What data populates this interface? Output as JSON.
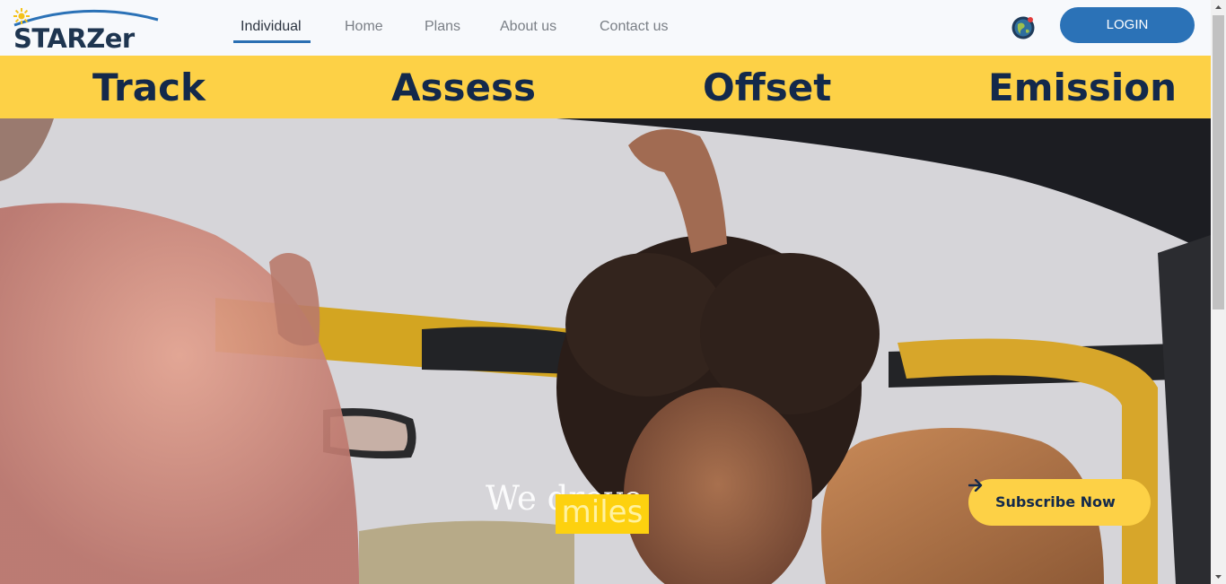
{
  "brand": {
    "logo_text": "STARZer",
    "logo_icon": "sun-icon"
  },
  "nav": {
    "items": [
      {
        "label": "Individual",
        "active": true
      },
      {
        "label": "Home",
        "active": false
      },
      {
        "label": "Plans",
        "active": false
      },
      {
        "label": "About us",
        "active": false
      },
      {
        "label": "Contact us",
        "active": false
      }
    ]
  },
  "header": {
    "language_icon": "globe-icon",
    "login_label": "LOGIN"
  },
  "band": {
    "words": [
      "Track",
      "Assess",
      "Offset",
      "Emission"
    ]
  },
  "hero": {
    "headline": "We drove",
    "highlight": "miles",
    "subscribe_label": "Subscribe Now",
    "subscribe_icon": "arrow-right-icon"
  },
  "colors": {
    "brand_blue": "#2b72b7",
    "brand_navy": "#13294b",
    "accent_yellow": "#fdd146",
    "highlight_yellow": "#fdd10f"
  }
}
